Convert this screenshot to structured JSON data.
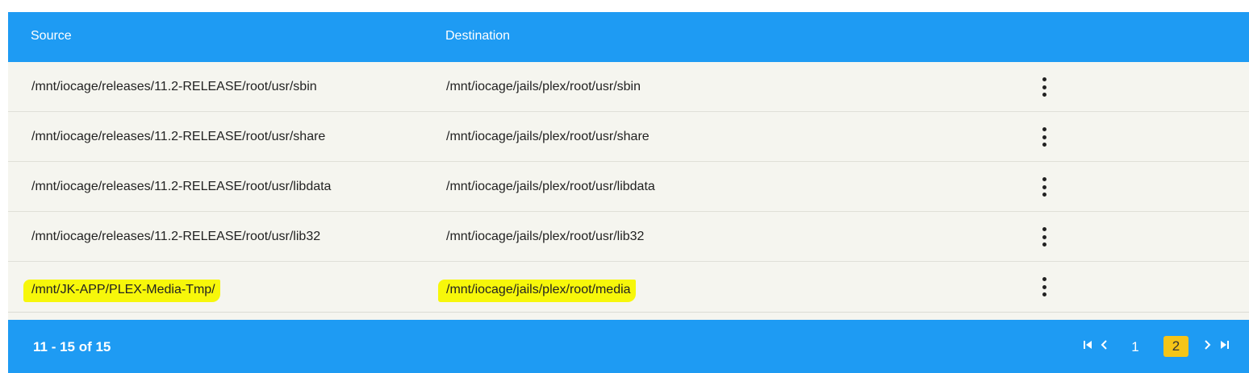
{
  "table": {
    "headers": {
      "source": "Source",
      "destination": "Destination"
    },
    "rows": [
      {
        "source": "/mnt/iocage/releases/11.2-RELEASE/root/usr/sbin",
        "destination": "/mnt/iocage/jails/plex/root/usr/sbin"
      },
      {
        "source": "/mnt/iocage/releases/11.2-RELEASE/root/usr/share",
        "destination": "/mnt/iocage/jails/plex/root/usr/share"
      },
      {
        "source": "/mnt/iocage/releases/11.2-RELEASE/root/usr/libdata",
        "destination": "/mnt/iocage/jails/plex/root/usr/libdata"
      },
      {
        "source": "/mnt/iocage/releases/11.2-RELEASE/root/usr/lib32",
        "destination": "/mnt/iocage/jails/plex/root/usr/lib32"
      },
      {
        "source": "/mnt/JK-APP/PLEX-Media-Tmp/",
        "destination": "/mnt/iocage/jails/plex/root/media",
        "highlighted": true
      }
    ],
    "row_menu_icon": "more-vert-icon"
  },
  "footer": {
    "range_label": "11 - 15 of 15",
    "pages": [
      "1",
      "2"
    ],
    "current_page": "2",
    "icons": [
      "first-page-icon",
      "prev-page-icon",
      "next-page-icon",
      "last-page-icon"
    ]
  },
  "colors": {
    "header_bg": "#1e9bf3",
    "row_bg": "#f5f5ef",
    "highlight": "#f7f70a",
    "active_page": "#f5c518"
  }
}
